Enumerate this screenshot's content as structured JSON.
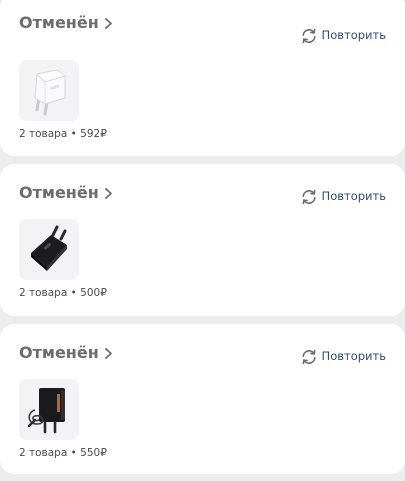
{
  "orders": [
    {
      "status": "Отменён",
      "repeat_label": "Повторить",
      "summary": "2 товара • 592₽"
    },
    {
      "status": "Отменён",
      "repeat_label": "Повторить",
      "summary": "2 товара • 500₽"
    },
    {
      "status": "Отменён",
      "repeat_label": "Повторить",
      "summary": "2 товара • 550₽"
    }
  ],
  "colors": {
    "background": "#ededf0",
    "card": "#ffffff",
    "status_text": "#6b6b73",
    "repeat_text": "#2e4d7a"
  },
  "icons": {
    "status_arrow": "chevron-right-icon",
    "repeat": "refresh-icon"
  }
}
